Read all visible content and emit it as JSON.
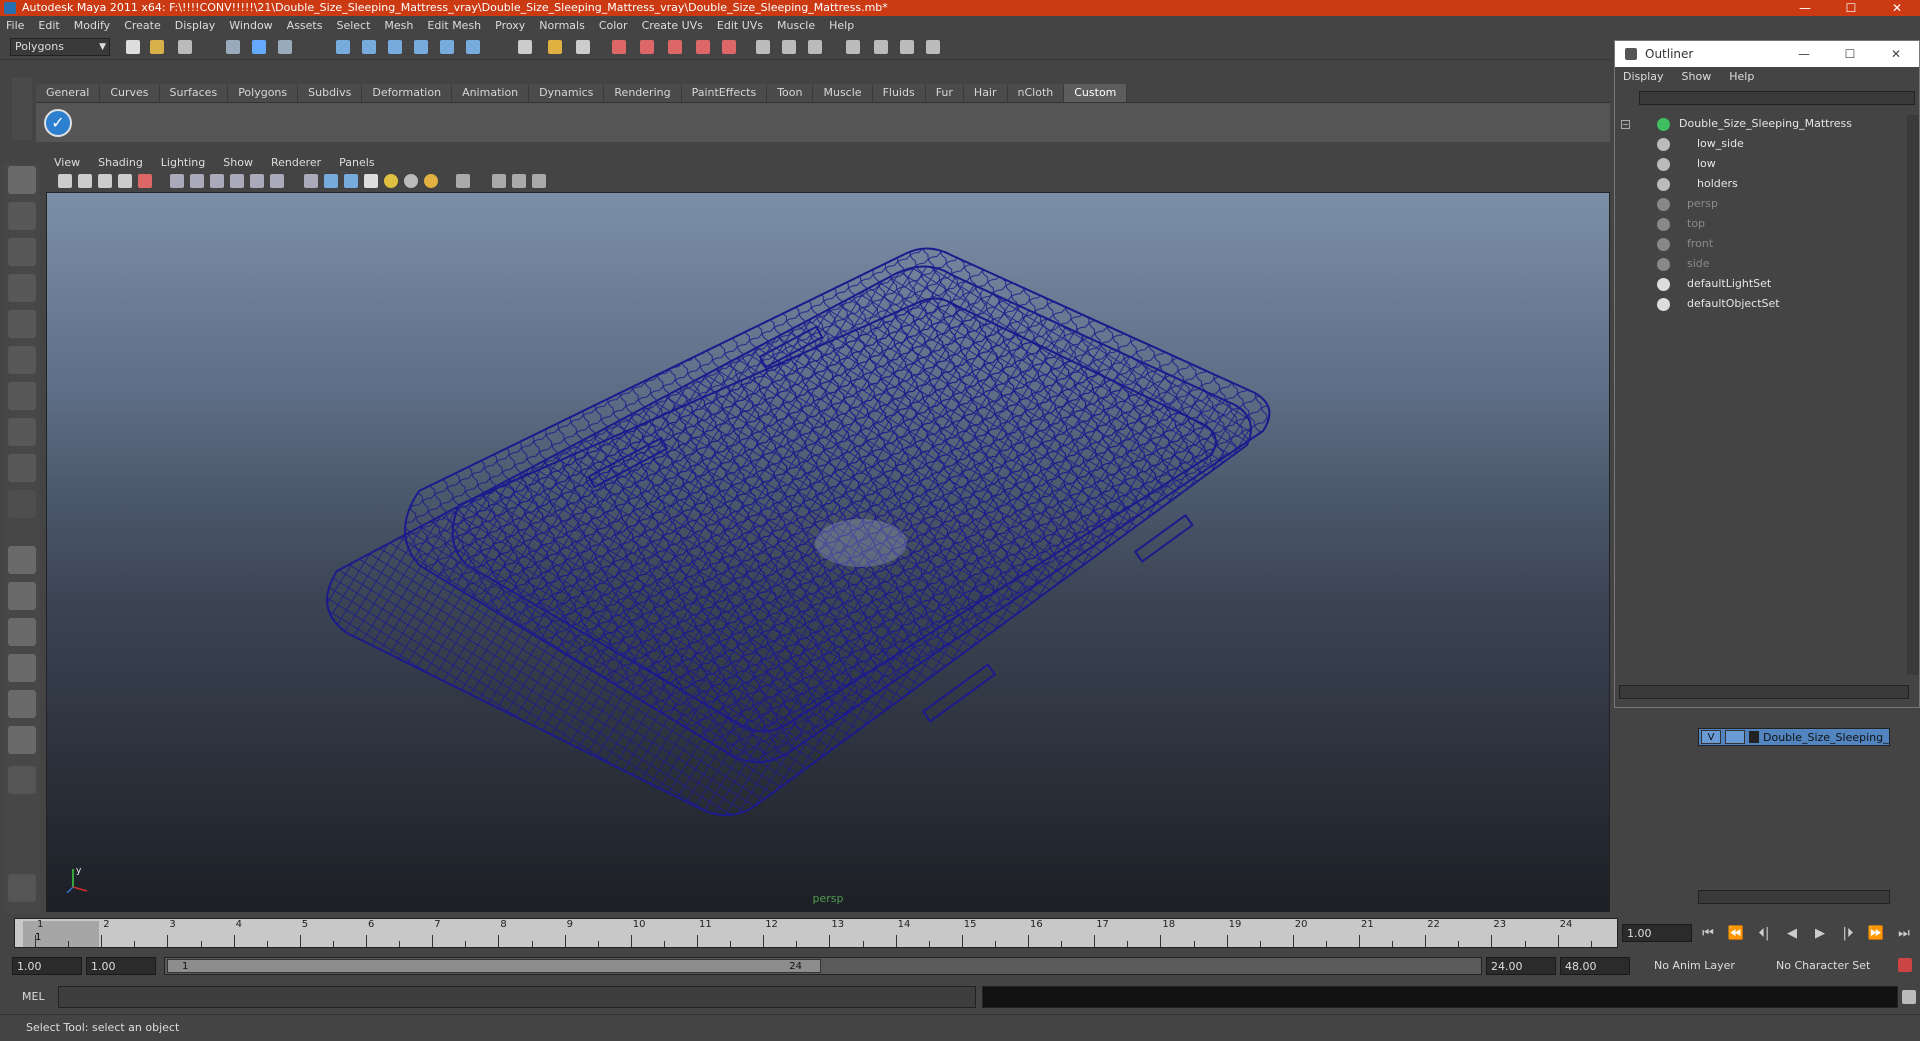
{
  "window": {
    "title": "Autodesk Maya 2011 x64: F:\\!!!!CONV!!!!!\\21\\Double_Size_Sleeping_Mattress_vray\\Double_Size_Sleeping_Mattress_vray\\Double_Size_Sleeping_Mattress.mb*",
    "minimize": "—",
    "maximize": "☐",
    "close": "✕"
  },
  "menubar": [
    "File",
    "Edit",
    "Modify",
    "Create",
    "Display",
    "Window",
    "Assets",
    "Select",
    "Mesh",
    "Edit Mesh",
    "Proxy",
    "Normals",
    "Color",
    "Create UVs",
    "Edit UVs",
    "Muscle",
    "Help"
  ],
  "statusline": {
    "mode": "Polygons"
  },
  "shelf": {
    "tabs": [
      "General",
      "Curves",
      "Surfaces",
      "Polygons",
      "Subdivs",
      "Deformation",
      "Animation",
      "Dynamics",
      "Rendering",
      "PaintEffects",
      "Toon",
      "Muscle",
      "Fluids",
      "Fur",
      "Hair",
      "nCloth",
      "Custom"
    ],
    "active_tab": "Custom"
  },
  "viewport": {
    "menu": [
      "View",
      "Shading",
      "Lighting",
      "Show",
      "Renderer",
      "Panels"
    ],
    "camera_label": "persp",
    "wire_color": "#1c1a8c"
  },
  "timeslider": {
    "ticks": [
      "1",
      "2",
      "3",
      "4",
      "5",
      "6",
      "7",
      "8",
      "9",
      "10",
      "11",
      "12",
      "13",
      "14",
      "15",
      "16",
      "17",
      "18",
      "19",
      "20",
      "21",
      "22",
      "23",
      "24"
    ],
    "current_frame_marker": "1",
    "current_frame": "1.00"
  },
  "playback": [
    "⏮",
    "⏪",
    "⏴|",
    "◀",
    "▶",
    "|⏵",
    "⏩",
    "⏭"
  ],
  "range": {
    "start_time": "1.00",
    "playback_start": "1.00",
    "handle_start": "1",
    "handle_end": "24",
    "playback_end": "24.00",
    "end_time": "48.00",
    "anim_layer": "No Anim Layer",
    "character_set": "No Character Set"
  },
  "commandline": {
    "label": "MEL"
  },
  "helpline": {
    "text": "Select Tool: select an object"
  },
  "outliner": {
    "title": "Outliner",
    "menu": [
      "Display",
      "Show",
      "Help"
    ],
    "items": [
      {
        "label": "Double_Size_Sleeping_Mattress",
        "dim": false
      },
      {
        "label": "low_side",
        "dim": false
      },
      {
        "label": "low",
        "dim": false
      },
      {
        "label": "holders",
        "dim": false
      },
      {
        "label": "persp",
        "dim": true
      },
      {
        "label": "top",
        "dim": true
      },
      {
        "label": "front",
        "dim": true
      },
      {
        "label": "side",
        "dim": true
      },
      {
        "label": "defaultLightSet",
        "dim": false
      },
      {
        "label": "defaultObjectSet",
        "dim": false
      }
    ]
  },
  "layers": {
    "items": [
      {
        "visible": "V",
        "name": "Double_Size_Sleeping_Ma"
      }
    ]
  }
}
